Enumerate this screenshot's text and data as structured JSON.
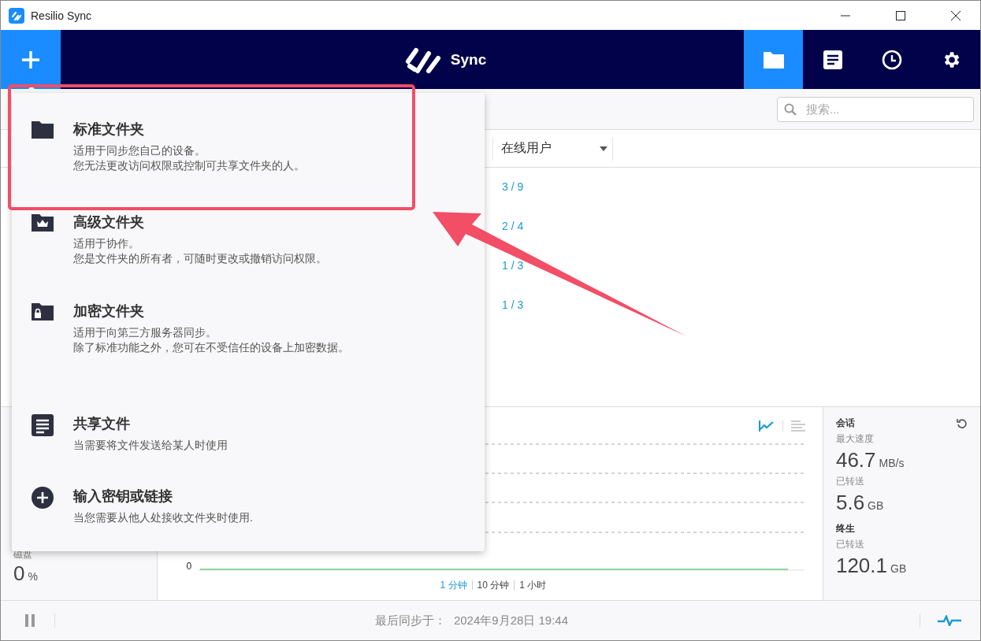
{
  "window": {
    "title": "Resilio Sync"
  },
  "header": {
    "logo_text": "Sync",
    "nav": [
      {
        "kind": "folder",
        "selected": true
      },
      {
        "kind": "document",
        "selected": false
      },
      {
        "kind": "history",
        "selected": false
      },
      {
        "kind": "settings",
        "selected": false
      }
    ]
  },
  "search": {
    "placeholder": "搜索..."
  },
  "table": {
    "columns": [
      {
        "label": "在线用户"
      }
    ],
    "rows": [
      {
        "online": "3 / 9"
      },
      {
        "online": "2 / 4"
      },
      {
        "online": "1 / 3"
      },
      {
        "online": "1 / 3"
      }
    ]
  },
  "add_menu": {
    "items": [
      {
        "kind": "folder",
        "title": "标准文件夹",
        "lines": [
          "适用于同步您自己的设备。",
          "您无法更改访问权限或控制可共享文件夹的人。"
        ]
      },
      {
        "kind": "crown",
        "title": "高级文件夹",
        "lines": [
          "适用于协作。",
          "您是文件夹的所有者，可随时更改或撤销访问权限。"
        ]
      },
      {
        "kind": "lock",
        "title": "加密文件夹",
        "lines": [
          "适用于向第三方服务器同步。",
          "除了标准功能之外，您可在不受信任的设备上加密数据。"
        ]
      },
      {
        "kind": "divider"
      },
      {
        "kind": "document",
        "title": "共享文件",
        "lines": [
          "当需要将文件发送给某人时使用"
        ]
      },
      {
        "kind": "plus",
        "title": "输入密钥或链接",
        "lines": [
          "当您需要从他人处接收文件夹时使用."
        ]
      }
    ]
  },
  "disk": {
    "label": "磁盘",
    "value": "0",
    "unit": "%"
  },
  "chart": {
    "y_tick": "0",
    "ranges": [
      {
        "label": "1 分钟",
        "selected": true
      },
      {
        "label": "10 分钟",
        "selected": false
      },
      {
        "label": "1 小时",
        "selected": false
      }
    ],
    "views": [
      {
        "kind": "line",
        "selected": true
      },
      {
        "kind": "bars",
        "selected": false
      }
    ]
  },
  "stats": {
    "session_title": "会话",
    "session": [
      {
        "label": "最大速度",
        "value": "46.7",
        "unit": "MB/s"
      },
      {
        "label": "已转送",
        "value": "5.6",
        "unit": "GB"
      }
    ],
    "lifetime_title": "终生",
    "lifetime": [
      {
        "label": "已转送",
        "value": "120.1",
        "unit": "GB"
      }
    ]
  },
  "status_bar": {
    "label": "最后同步于：",
    "time": "2024年9月28日 19:44"
  }
}
